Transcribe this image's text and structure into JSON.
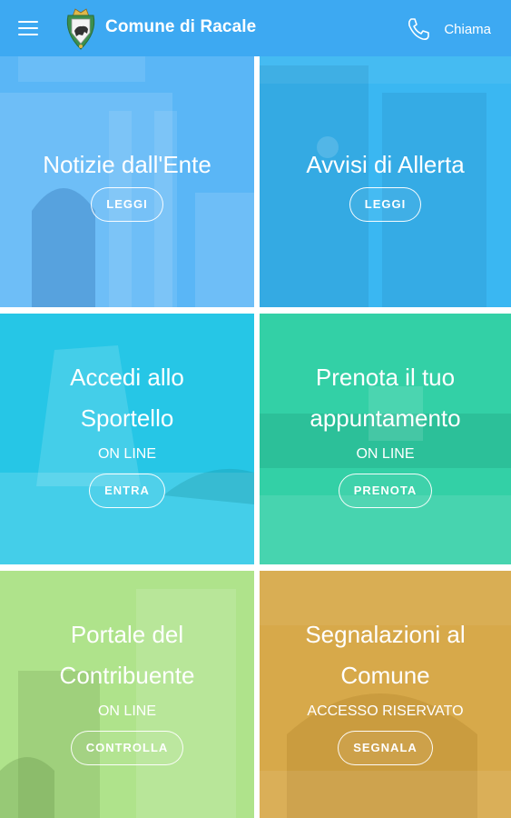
{
  "header": {
    "title": "Comune di Racale",
    "call_label": "Chiama",
    "menu_icon": "hamburger-menu-icon",
    "phone_icon": "phone-icon",
    "color": "#3da9f2"
  },
  "tiles": [
    {
      "title_lines": [
        "Notizie dall'Ente"
      ],
      "subtitle": "",
      "button": "LEGGI",
      "color": "#5ab6f6"
    },
    {
      "title_lines": [
        "Avvisi di Allerta"
      ],
      "subtitle": "",
      "button": "LEGGI",
      "color": "#3ab7f2"
    },
    {
      "title_lines": [
        "Accedi allo",
        "Sportello"
      ],
      "subtitle": "ON LINE",
      "button": "ENTRA",
      "color": "#26c6e6"
    },
    {
      "title_lines": [
        "Prenota il tuo",
        "appuntamento"
      ],
      "subtitle": "ON LINE",
      "button": "PRENOTA",
      "color": "#33d0a6"
    },
    {
      "title_lines": [
        "Portale del",
        "Contribuente"
      ],
      "subtitle": "ON LINE",
      "button": "CONTROLLA",
      "color": "#a6e07e"
    },
    {
      "title_lines": [
        "Segnalazioni al",
        "Comune"
      ],
      "subtitle": "ACCESSO RISERVATO",
      "button": "SEGNALA",
      "color": "#d7a94a"
    }
  ]
}
